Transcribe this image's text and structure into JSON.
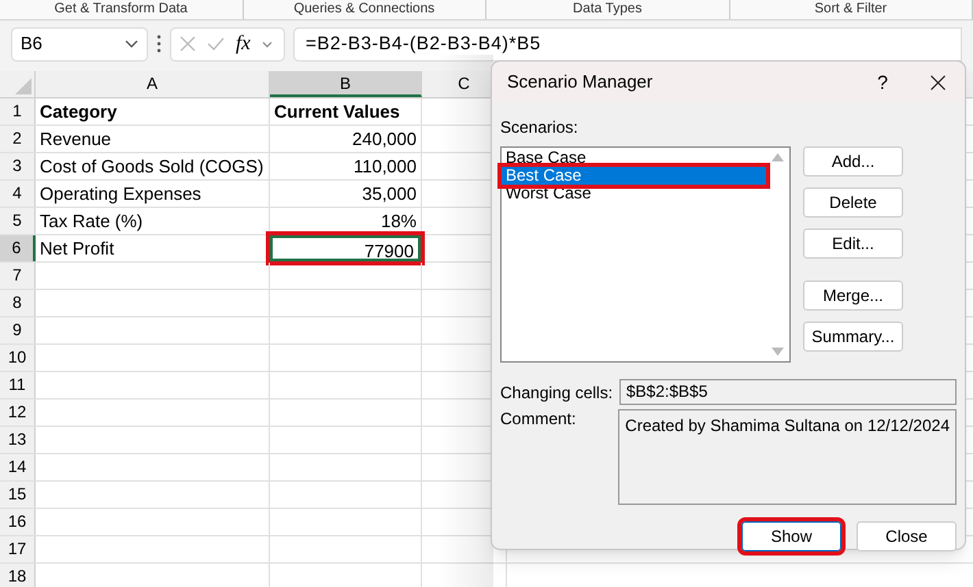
{
  "ribbon_groups": [
    "Get & Transform Data",
    "Queries & Connections",
    "Data Types",
    "Sort & Filter"
  ],
  "formula_bar": {
    "name_box": "B6",
    "fx": "fx",
    "formula": "=B2-B3-B4-(B2-B3-B4)*B5"
  },
  "columns": [
    {
      "label": "A",
      "selected": false
    },
    {
      "label": "B",
      "selected": true
    },
    {
      "label": "C",
      "selected": false
    }
  ],
  "rows": [
    {
      "number": "1",
      "selected": false,
      "kind": "header",
      "cells": [
        {
          "text": "Category"
        },
        {
          "text": "Current Values"
        }
      ]
    },
    {
      "number": "2",
      "selected": false,
      "kind": "data",
      "cells": [
        {
          "text": "Revenue"
        },
        {
          "text": "240,000"
        }
      ]
    },
    {
      "number": "3",
      "selected": false,
      "kind": "data",
      "cells": [
        {
          "text": "Cost of Goods Sold (COGS)"
        },
        {
          "text": "110,000"
        }
      ]
    },
    {
      "number": "4",
      "selected": false,
      "kind": "data",
      "cells": [
        {
          "text": "Operating Expenses"
        },
        {
          "text": "35,000"
        }
      ]
    },
    {
      "number": "5",
      "selected": false,
      "kind": "data",
      "cells": [
        {
          "text": "Tax Rate (%)"
        },
        {
          "text": "18%"
        }
      ]
    },
    {
      "number": "6",
      "selected": true,
      "kind": "data",
      "cells": [
        {
          "text": "Net Profit"
        },
        {
          "text": "77900",
          "active": true,
          "highlighted": true
        }
      ]
    },
    {
      "number": "7",
      "selected": false,
      "kind": "empty",
      "cells": []
    },
    {
      "number": "8",
      "selected": false,
      "kind": "empty",
      "cells": []
    },
    {
      "number": "9",
      "selected": false,
      "kind": "empty",
      "cells": []
    },
    {
      "number": "10",
      "selected": false,
      "kind": "empty",
      "cells": []
    },
    {
      "number": "11",
      "selected": false,
      "kind": "empty",
      "cells": []
    },
    {
      "number": "12",
      "selected": false,
      "kind": "empty",
      "cells": []
    },
    {
      "number": "13",
      "selected": false,
      "kind": "empty",
      "cells": []
    },
    {
      "number": "14",
      "selected": false,
      "kind": "empty",
      "cells": []
    },
    {
      "number": "15",
      "selected": false,
      "kind": "empty",
      "cells": []
    },
    {
      "number": "16",
      "selected": false,
      "kind": "empty",
      "cells": []
    },
    {
      "number": "17",
      "selected": false,
      "kind": "empty",
      "cells": []
    },
    {
      "number": "18",
      "selected": false,
      "kind": "empty",
      "cells": []
    }
  ],
  "dialog": {
    "title": "Scenario Manager",
    "help": "?",
    "scenarios_label": "Scenarios:",
    "scenarios": [
      {
        "name": "Base Case",
        "selected": false,
        "highlighted": false
      },
      {
        "name": "Best Case",
        "selected": true,
        "highlighted": true
      },
      {
        "name": "Worst Case",
        "selected": false,
        "highlighted": false
      }
    ],
    "side_button_groups": [
      [
        "Add...",
        "Delete",
        "Edit..."
      ],
      [
        "Merge...",
        "Summary..."
      ]
    ],
    "changing_cells_label": "Changing cells:",
    "changing_cells": "$B$2:$B$5",
    "comment_label": "Comment:",
    "comment": "Created by Shamima Sultana on 12/12/2024",
    "bottom_buttons": [
      {
        "label": "Show",
        "highlighted": true
      },
      {
        "label": "Close",
        "highlighted": false
      }
    ]
  }
}
